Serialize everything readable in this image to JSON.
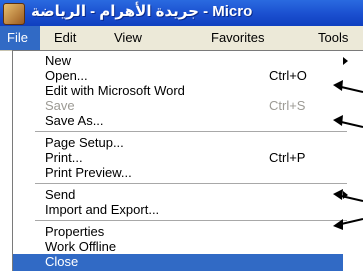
{
  "window": {
    "title": "Micro - جريدة الأهرام - الرياضة"
  },
  "menubar": {
    "file": "File",
    "edit": "Edit",
    "view": "View",
    "favorites": "Favorites",
    "tools": "Tools"
  },
  "file_menu": {
    "new": "New",
    "open": "Open...",
    "open_shortcut": "Ctrl+O",
    "edit_word": "Edit with Microsoft Word",
    "save": "Save",
    "save_shortcut": "Ctrl+S",
    "save_as": "Save As...",
    "page_setup": "Page Setup...",
    "print": "Print...",
    "print_shortcut": "Ctrl+P",
    "print_preview": "Print Preview...",
    "send": "Send",
    "import_export": "Import and Export...",
    "properties": "Properties",
    "work_offline": "Work Offline",
    "close": "Close"
  },
  "colors": {
    "titlebar": "#1a4fcf",
    "menu_highlight": "#316ac5",
    "menubar_bg": "#ece9d8",
    "disabled_text": "#9c9a94"
  },
  "icons": {
    "app": "ie-app-icon",
    "submenu": "submenu-arrow-icon",
    "annotation": "pointer-arrow-icon"
  }
}
